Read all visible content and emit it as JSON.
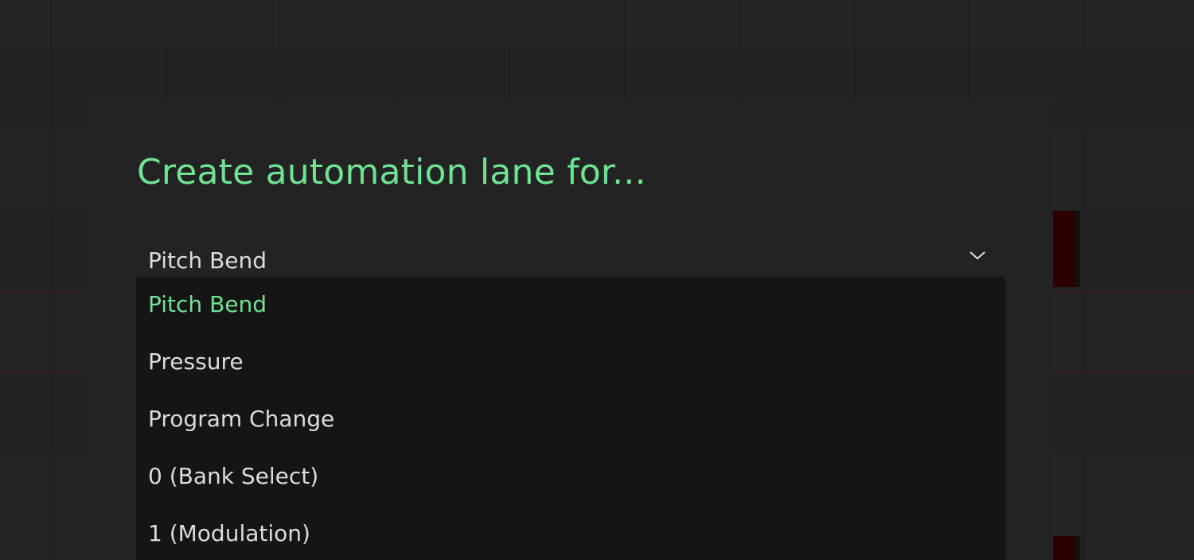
{
  "dialog": {
    "title": "Create automation lane for..."
  },
  "select": {
    "value": "Pitch Bend",
    "icon": "chevron-down-icon"
  },
  "menu": {
    "items": [
      {
        "label": "Pitch Bend",
        "selected": true
      },
      {
        "label": "Pressure",
        "selected": false
      },
      {
        "label": "Program Change",
        "selected": false
      },
      {
        "label": "0 (Bank Select)",
        "selected": false
      },
      {
        "label": "1 (Modulation)",
        "selected": false
      }
    ]
  },
  "colors": {
    "accent": "#6ee394",
    "background": "#232323",
    "menu_background": "#151515",
    "text": "#dcdcdc",
    "clip": "#2a0000"
  }
}
